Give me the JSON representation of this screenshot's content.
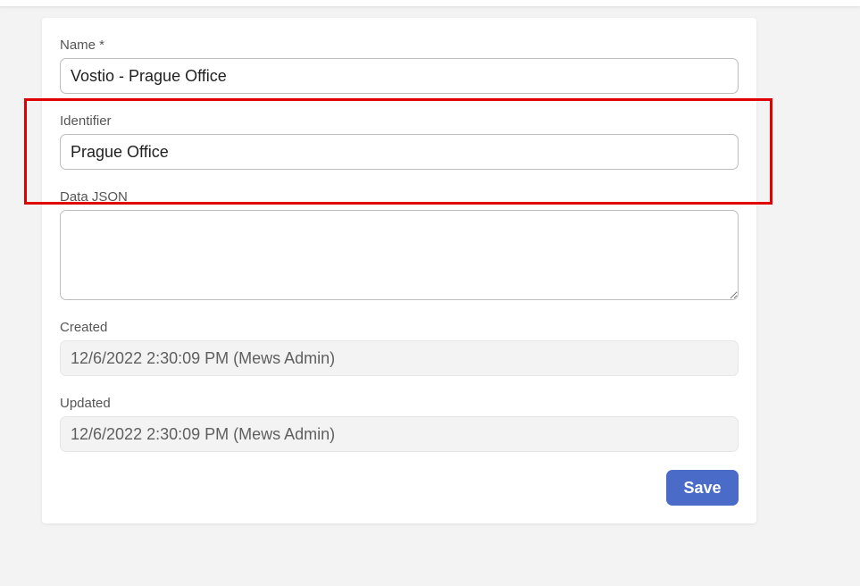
{
  "form": {
    "name": {
      "label": "Name *",
      "value": "Vostio - Prague Office"
    },
    "identifier": {
      "label": "Identifier",
      "value": "Prague Office"
    },
    "data_json": {
      "label": "Data JSON",
      "value": ""
    },
    "created": {
      "label": "Created",
      "value": "12/6/2022 2:30:09 PM (Mews Admin)"
    },
    "updated": {
      "label": "Updated",
      "value": "12/6/2022 2:30:09 PM (Mews Admin)"
    },
    "save_label": "Save"
  },
  "colors": {
    "primary": "#4a6cc8",
    "highlight": "#e00000",
    "background": "#f3f3f3",
    "readonly_field": "#f3f3f3"
  }
}
